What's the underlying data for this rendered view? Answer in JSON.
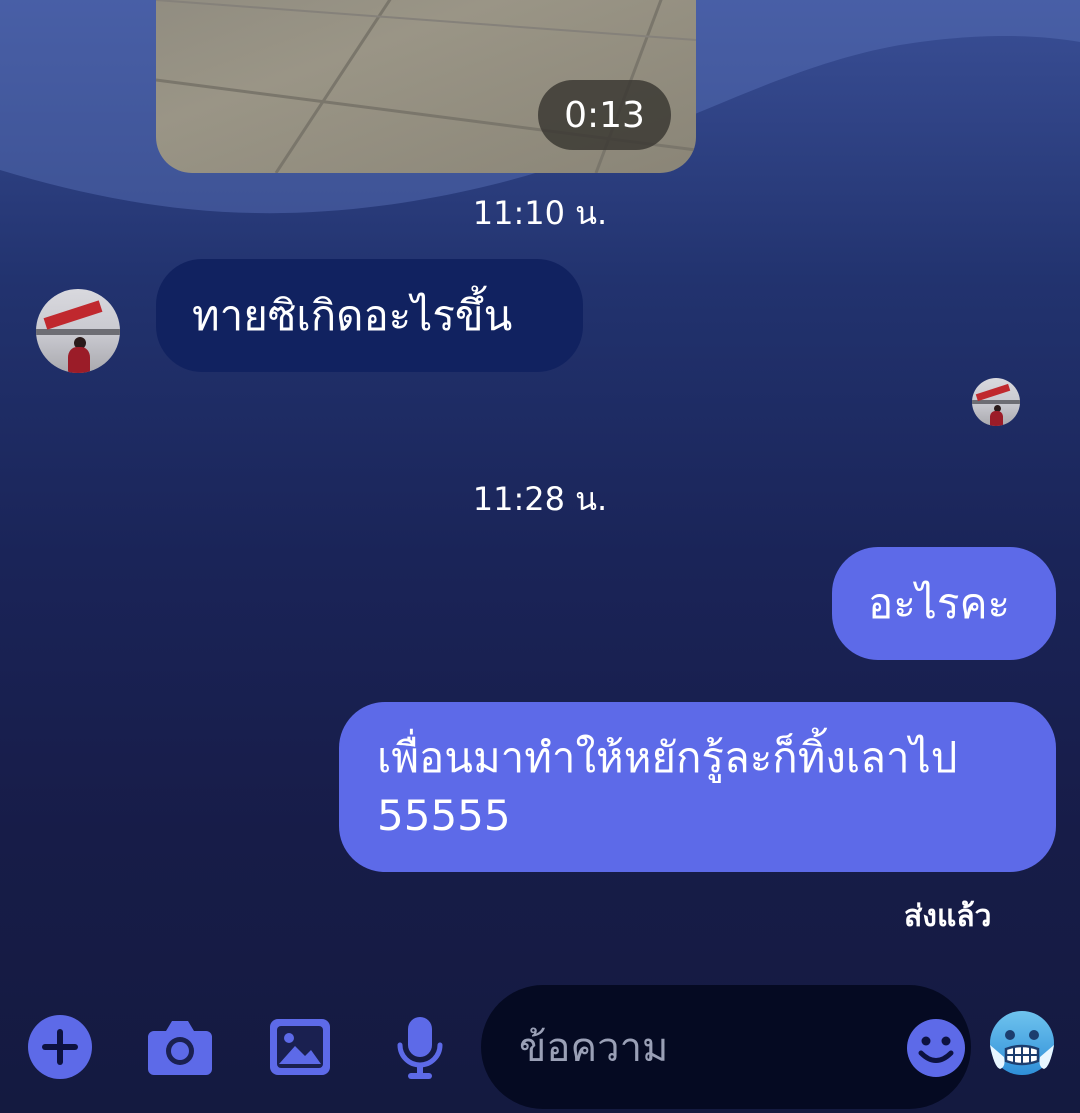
{
  "messages": {
    "video": {
      "duration": "0:13"
    },
    "time_1": "11:10 น.",
    "incoming_1": "ทายซิเกิดอะไรขึ้น",
    "time_2": "11:28 น.",
    "outgoing_1": "อะไรคะ",
    "outgoing_2_line1": "เพื่อนมาทำให้หยักรู้ละก็ทิ้งเลาไป",
    "outgoing_2_line2": "55555",
    "status": "ส่งแล้ว"
  },
  "composer": {
    "placeholder": "ข้อความ",
    "icons": [
      "plus-icon",
      "camera-icon",
      "image-icon",
      "microphone-icon",
      "emoji-smile-icon",
      "cold-face-emoji-icon"
    ]
  },
  "colors": {
    "incoming_bubble": "#112260",
    "outgoing_bubble": "#5d6ae8",
    "accent": "#5d6ae8",
    "input_bg": "#050a22"
  }
}
